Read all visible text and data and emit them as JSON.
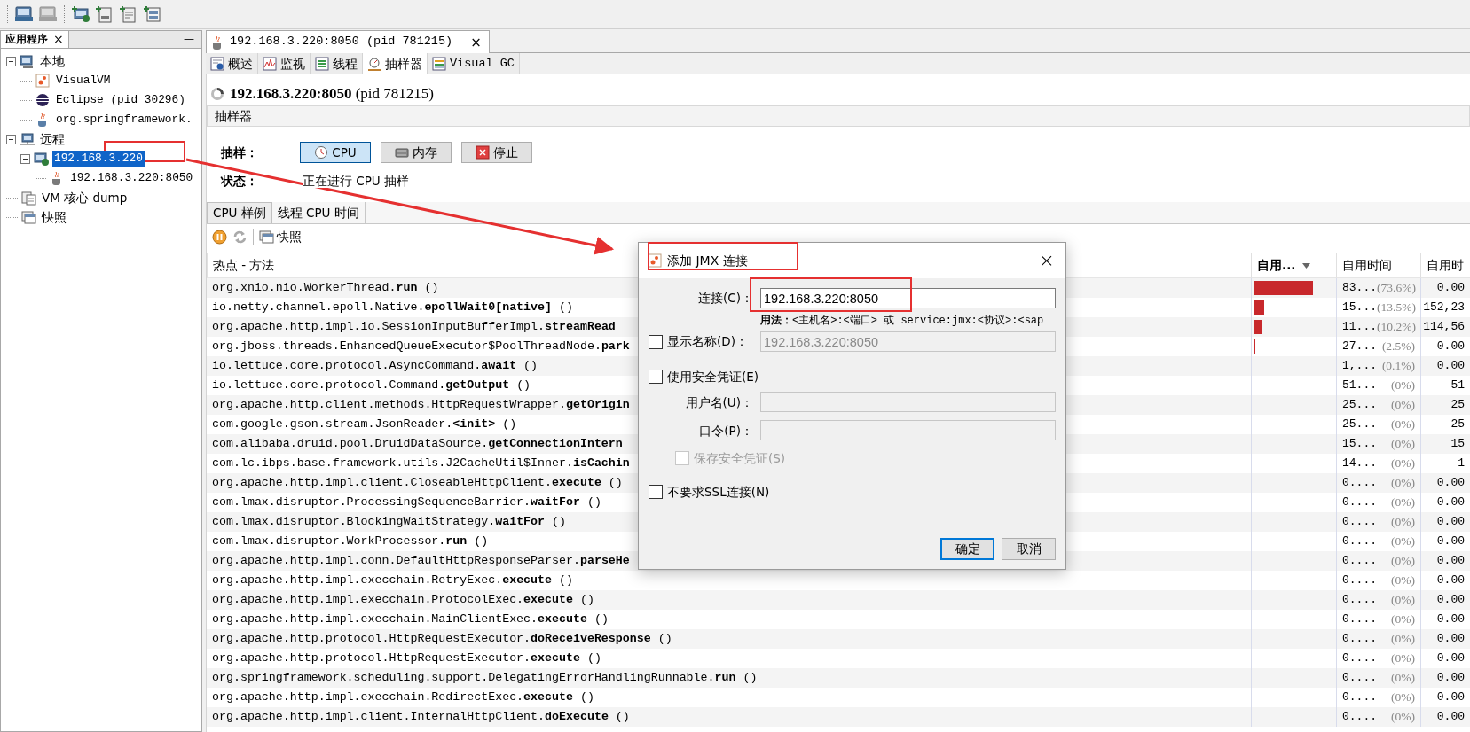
{
  "sidebar": {
    "title": "应用程序",
    "close": "×",
    "minimize": "—",
    "tree": [
      {
        "label": "本地",
        "kind": "host",
        "expanded": true,
        "selected": false,
        "children": [
          {
            "label": "VisualVM",
            "kind": "visualvm",
            "selected": false
          },
          {
            "label": "Eclipse (pid 30296)",
            "kind": "eclipse",
            "selected": false
          },
          {
            "label": "org.springframework.",
            "kind": "java",
            "selected": false
          }
        ]
      },
      {
        "label": "远程",
        "kind": "remote",
        "expanded": true,
        "selected": false,
        "children": [
          {
            "label": "192.168.3.220",
            "kind": "remote-host",
            "expanded": true,
            "selected": true,
            "children": [
              {
                "label": "192.168.3.220:8050",
                "kind": "jmx",
                "selected": false
              }
            ]
          }
        ]
      },
      {
        "label": "VM 核心 dump",
        "kind": "dump",
        "selected": false
      },
      {
        "label": "快照",
        "kind": "snapshot",
        "selected": false
      }
    ]
  },
  "document_tab": {
    "title": "192.168.3.220:8050 (pid 781215)",
    "close": "×"
  },
  "view_tabs": [
    {
      "label": "概述",
      "kind": "overview",
      "selected": false
    },
    {
      "label": "监视",
      "kind": "monitor",
      "selected": false
    },
    {
      "label": "线程",
      "kind": "threads",
      "selected": false
    },
    {
      "label": "抽样器",
      "kind": "sampler",
      "selected": true
    },
    {
      "label": "Visual GC",
      "kind": "gc",
      "selected": false
    }
  ],
  "heading": "**192.168.3.220:8050** (pid 781215)",
  "section_title": "抽样器",
  "sampling": {
    "label": "抽样：",
    "buttons": [
      {
        "label": "CPU",
        "kind": "cpu",
        "selected": true
      },
      {
        "label": "内存",
        "kind": "memory",
        "selected": false
      },
      {
        "label": "停止",
        "kind": "stop",
        "selected": false
      }
    ],
    "status_label": "状态：",
    "status": "正在进行 CPU 抽样"
  },
  "result_tabs": [
    {
      "label": "CPU 样例",
      "selected": true
    },
    {
      "label": "线程 CPU 时间",
      "selected": false
    }
  ],
  "result_tools": [
    {
      "kind": "pause",
      "disabled": false
    },
    {
      "kind": "refresh",
      "disabled": true
    },
    {
      "kind": "snapshot",
      "label": "快照",
      "disabled": false
    }
  ],
  "table": {
    "columns": [
      {
        "label": "热点 - 方法",
        "sorted": false
      },
      {
        "label": "自用...",
        "sorted": true
      },
      {
        "label": "自用时间",
        "sorted": false
      },
      {
        "label": "自用时",
        "sorted": false
      }
    ],
    "rows": [
      {
        "method": "org.xnio.nio.WorkerThread.**run** ()",
        "level": 0.736,
        "time": "83...",
        "percent": "(73.6%)",
        "column_4": "0.00"
      },
      {
        "method": "io.netty.channel.epoll.Native.**epollWait0[native]** ()",
        "level": 0.135,
        "time": "15...",
        "percent": "(13.5%)",
        "column_4": "152,23"
      },
      {
        "method": "org.apache.http.impl.io.SessionInputBufferImpl.**streamRead**",
        "level": 0.102,
        "time": "11...",
        "percent": "(10.2%)",
        "column_4": "114,56"
      },
      {
        "method": "org.jboss.threads.EnhancedQueueExecutor$PoolThreadNode.**park**",
        "level": 0.025,
        "time": "27...",
        "percent": "(2.5%)",
        "column_4": "0.00"
      },
      {
        "method": "io.lettuce.core.protocol.AsyncCommand.**await** ()",
        "time": "1,...",
        "percent": "(0.1%)",
        "column_4": "0.00"
      },
      {
        "method": "io.lettuce.core.protocol.Command.**getOutput** ()",
        "time": "51...",
        "percent": "(0%)",
        "column_4": "51"
      },
      {
        "method": "org.apache.http.client.methods.HttpRequestWrapper.**getOrigin**",
        "time": "25...",
        "percent": "(0%)",
        "column_4": "25"
      },
      {
        "method": "com.google.gson.stream.JsonReader.**<init>** ()",
        "time": "25...",
        "percent": "(0%)",
        "column_4": "25"
      },
      {
        "method": "com.alibaba.druid.pool.DruidDataSource.**getConnectionIntern**",
        "time": "15...",
        "percent": "(0%)",
        "column_4": "15"
      },
      {
        "method": "com.lc.ibps.base.framework.utils.J2CacheUtil$Inner.**isCachin**",
        "time": "14...",
        "percent": "(0%)",
        "column_4": "1"
      },
      {
        "method": "org.apache.http.impl.client.CloseableHttpClient.**execute** ()",
        "time": "0....",
        "percent": "(0%)",
        "column_4": "0.00"
      },
      {
        "method": "com.lmax.disruptor.ProcessingSequenceBarrier.**waitFor** ()",
        "time": "0....",
        "percent": "(0%)",
        "column_4": "0.00"
      },
      {
        "method": "com.lmax.disruptor.BlockingWaitStrategy.**waitFor** ()",
        "time": "0....",
        "percent": "(0%)",
        "column_4": "0.00"
      },
      {
        "method": "com.lmax.disruptor.WorkProcessor.**run** ()",
        "time": "0....",
        "percent": "(0%)",
        "column_4": "0.00"
      },
      {
        "method": "org.apache.http.impl.conn.DefaultHttpResponseParser.**parseHe**",
        "time": "0....",
        "percent": "(0%)",
        "column_4": "0.00"
      },
      {
        "method": "org.apache.http.impl.execchain.RetryExec.**execute** ()",
        "time": "0....",
        "percent": "(0%)",
        "column_4": "0.00"
      },
      {
        "method": "org.apache.http.impl.execchain.ProtocolExec.**execute** ()",
        "time": "0....",
        "percent": "(0%)",
        "column_4": "0.00"
      },
      {
        "method": "org.apache.http.impl.execchain.MainClientExec.**execute** ()",
        "time": "0....",
        "percent": "(0%)",
        "column_4": "0.00"
      },
      {
        "method": "org.apache.http.protocol.HttpRequestExecutor.**doReceiveResponse** ()",
        "time": "0....",
        "percent": "(0%)",
        "column_4": "0.00"
      },
      {
        "method": "org.apache.http.protocol.HttpRequestExecutor.**execute** ()",
        "time": "0....",
        "percent": "(0%)",
        "column_4": "0.00"
      },
      {
        "method": "org.springframework.scheduling.support.DelegatingErrorHandlingRunnable.**run** ()",
        "time": "0....",
        "percent": "(0%)",
        "column_4": "0.00"
      },
      {
        "method": "org.apache.http.impl.execchain.RedirectExec.**execute** ()",
        "time": "0....",
        "percent": "(0%)",
        "column_4": "0.00"
      },
      {
        "method": "org.apache.http.impl.client.InternalHttpClient.**doExecute** ()",
        "time": "0....",
        "percent": "(0%)",
        "column_4": "0.00"
      }
    ]
  },
  "dialog": {
    "title": "添加 JMX 连接",
    "close": "×",
    "connection": {
      "label": "连接(C)：",
      "value": "192.168.3.220:8050"
    },
    "hint": "**用法：**<主机名>:<端口> 或 service:jmx:<协议>:<sap",
    "display_name": {
      "label": "显示名称(D)：",
      "checked": false,
      "value": "192.168.3.220:8050",
      "disabled": true
    },
    "use_credentials": {
      "label": "使用安全凭证(E)",
      "checked": false
    },
    "username": {
      "label": "用户名(U)：",
      "disabled": true
    },
    "password": {
      "label": "口令(P)：",
      "disabled": true
    },
    "save_credentials": {
      "label": "保存安全凭证(S)",
      "checked": false,
      "disabled": true
    },
    "no_ssl": {
      "label": "不要求SSL连接(N)",
      "checked": false
    },
    "buttons": [
      {
        "label": "确定",
        "default": true
      },
      {
        "label": "取消",
        "default": false
      }
    ]
  }
}
